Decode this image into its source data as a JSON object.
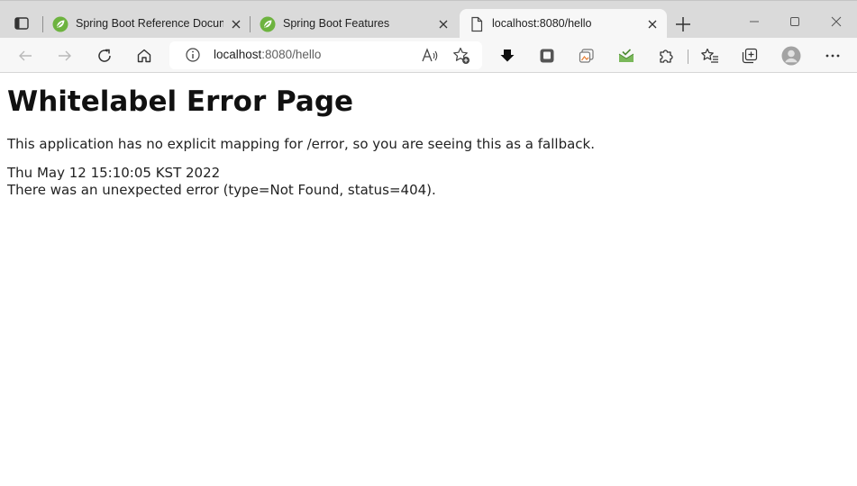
{
  "tabs": [
    {
      "title": "Spring Boot Reference Documentation",
      "favicon": "spring-leaf-icon",
      "active": false
    },
    {
      "title": "Spring Boot Features",
      "favicon": "spring-leaf-icon",
      "active": false
    },
    {
      "title": "localhost:8080/hello",
      "favicon": "page-icon",
      "active": true
    }
  ],
  "address_bar": {
    "host": "localhost",
    "path": ":8080/hello"
  },
  "page": {
    "heading": "Whitelabel Error Page",
    "description": "This application has no explicit mapping for /error, so you are seeing this as a fallback.",
    "timestamp": "Thu May 12 15:10:05 KST 2022",
    "error_message": "There was an unexpected error (type=Not Found, status=404)."
  },
  "colors": {
    "spring_green": "#6db33f",
    "tab_strip": "#dadada",
    "toolbar": "#f7f7f7"
  }
}
